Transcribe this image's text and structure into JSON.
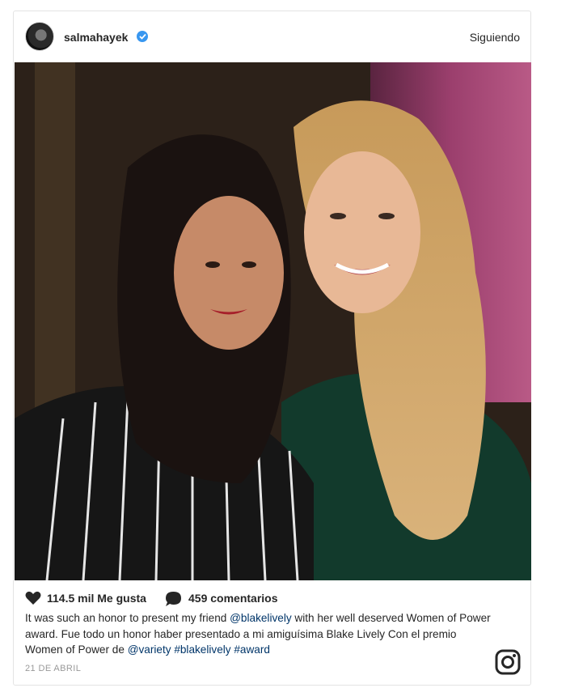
{
  "post": {
    "username": "salmahayek",
    "follow_status": "Siguiendo",
    "likes": "114.5 mil Me gusta",
    "comments": "459 comentarios",
    "caption": {
      "part1": "It was such an honor to present my friend ",
      "mention1": "@blakelively",
      "part2": " with her well deserved Women of Power award. Fue todo un honor haber presentado a mi amiguísima Blake Lively Con el premio Women of Power de ",
      "mention2": "@variety",
      "space1": " ",
      "hashtag1": "#blakelively",
      "space2": " ",
      "hashtag2": "#award"
    },
    "date": "21 DE ABRIL"
  },
  "colors": {
    "verified": "#3897f0",
    "link": "#003569"
  },
  "icons": {
    "verified": "verified-badge-icon",
    "like": "heart-icon",
    "comment": "speech-bubble-icon",
    "logo": "instagram-logo-icon"
  }
}
